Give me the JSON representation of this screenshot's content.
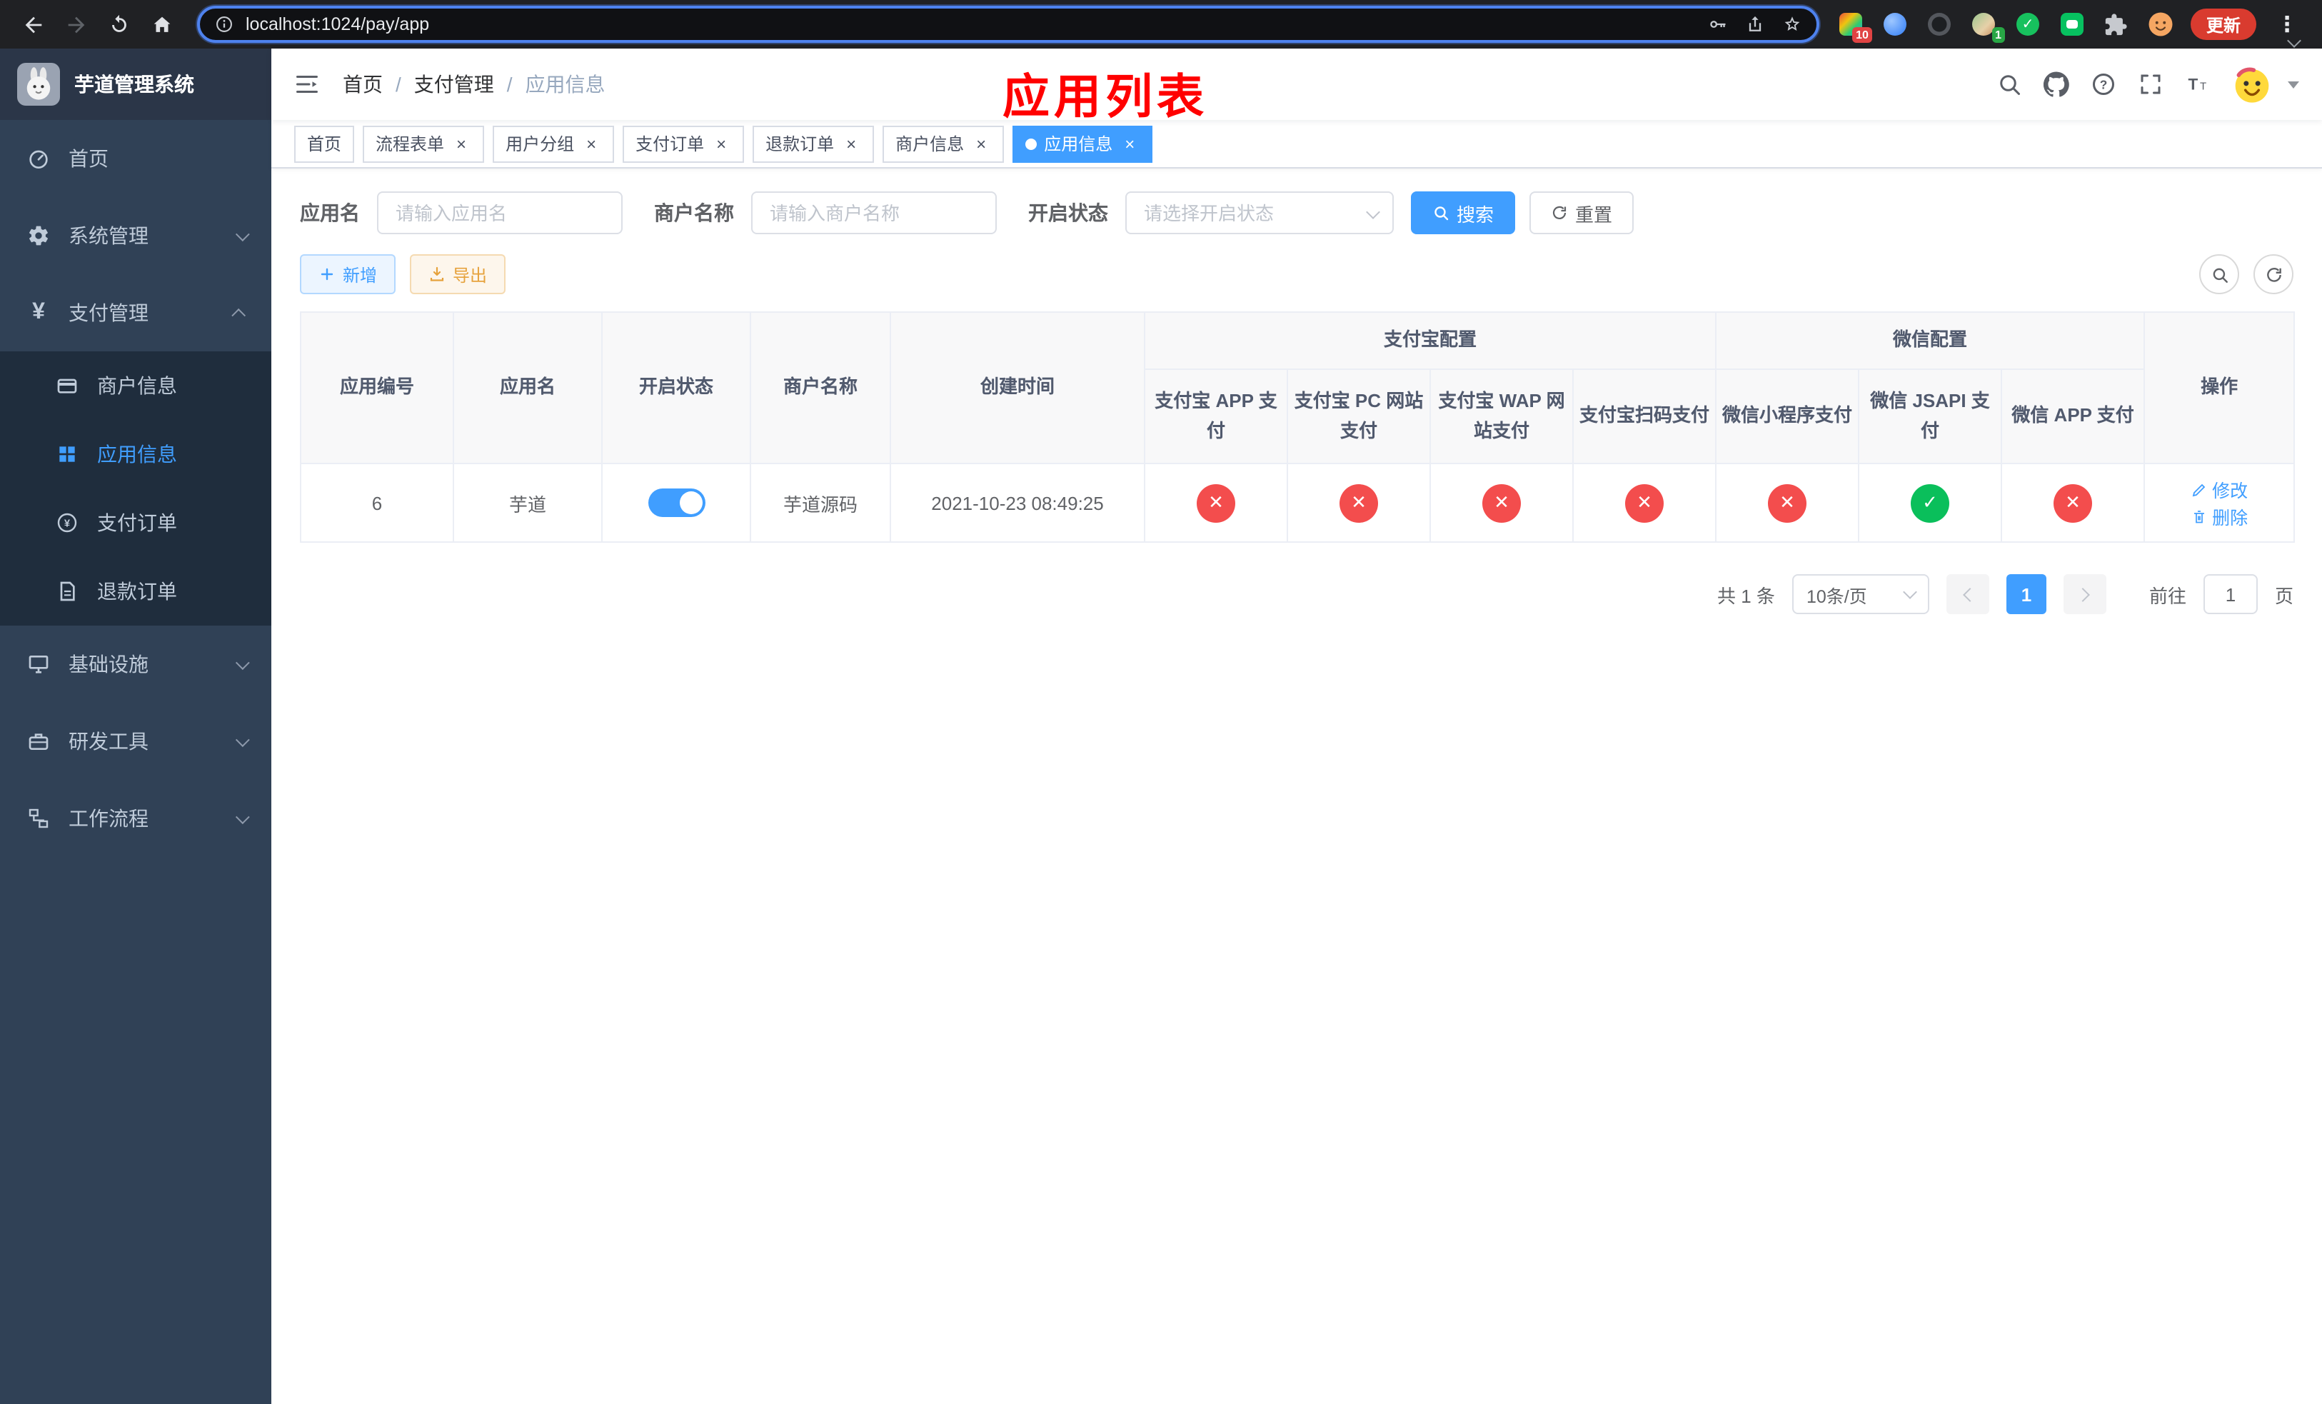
{
  "browser": {
    "url": "localhost:1024/pay/app",
    "update_label": "更新",
    "ext_badge_10": "10",
    "ext_badge_1": "1"
  },
  "app": {
    "logo_title": "芋道管理系统"
  },
  "sidebar": {
    "home": "首页",
    "system": "系统管理",
    "pay": "支付管理",
    "merchant": "商户信息",
    "appinfo": "应用信息",
    "payorder": "支付订单",
    "refund": "退款订单",
    "infra": "基础设施",
    "devtool": "研发工具",
    "workflow": "工作流程"
  },
  "header": {
    "breadcrumb_home": "首页",
    "breadcrumb_pay": "支付管理",
    "breadcrumb_app": "应用信息",
    "annotation": "应用列表"
  },
  "ui": {
    "separator": "/",
    "close": "×"
  },
  "tabs": [
    {
      "label": "首页"
    },
    {
      "label": "流程表单"
    },
    {
      "label": "用户分组"
    },
    {
      "label": "支付订单"
    },
    {
      "label": "退款订单"
    },
    {
      "label": "商户信息"
    },
    {
      "label": "应用信息"
    }
  ],
  "filter": {
    "app_name_label": "应用名",
    "app_name_placeholder": "请输入应用名",
    "merchant_label": "商户名称",
    "merchant_placeholder": "请输入商户名称",
    "status_label": "开启状态",
    "status_placeholder": "请选择开启状态",
    "search": "搜索",
    "reset": "重置"
  },
  "toolbar": {
    "add": "新增",
    "export": "导出"
  },
  "table": {
    "group_alipay": "支付宝配置",
    "group_wechat": "微信配置",
    "col_id": "应用编号",
    "col_name": "应用名",
    "col_status": "开启状态",
    "col_merchant": "商户名称",
    "col_created": "创建时间",
    "col_alipay_app": "支付宝 APP 支付",
    "col_alipay_pc": "支付宝 PC 网站支付",
    "col_alipay_wap": "支付宝 WAP 网站支付",
    "col_alipay_qr": "支付宝扫码支付",
    "col_wx_mini": "微信小程序支付",
    "col_wx_jsapi": "微信 JSAPI 支付",
    "col_wx_app": "微信 APP 支付",
    "col_actions": "操作",
    "row": {
      "id": "6",
      "name": "芋道",
      "enabled": true,
      "merchant": "芋道源码",
      "created": "2021-10-23 08:49:25",
      "alipay_app": false,
      "alipay_pc": false,
      "alipay_wap": false,
      "alipay_qr": false,
      "wx_mini": false,
      "wx_jsapi": true,
      "wx_app": false,
      "edit": "修改",
      "delete": "删除"
    }
  },
  "pagination": {
    "total": "共 1 条",
    "page_size": "10条/页",
    "page": "1",
    "goto": "前往",
    "goto_value": "1",
    "unit": "页"
  },
  "colors": {
    "primary": "#409eff",
    "danger": "#f34d4d",
    "success": "#0abf5b",
    "sidebar_bg": "#304156",
    "submenu_bg": "#1f2d3d",
    "annotation": "#ff0000"
  }
}
